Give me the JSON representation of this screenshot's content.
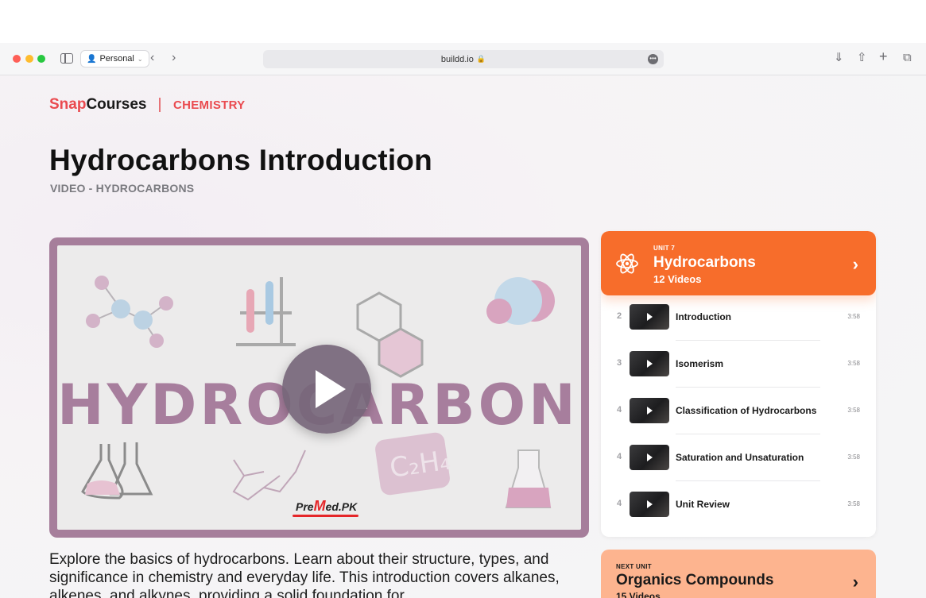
{
  "browser": {
    "profile_label": "Personal",
    "url": "buildd.io"
  },
  "brand": {
    "snap": "Snap",
    "courses": "Courses",
    "subject": "CHEMISTRY"
  },
  "page": {
    "title": "Hydrocarbons Introduction",
    "subtitle": "VIDEO - HYDROCARBONS",
    "description": "Explore the basics of hydrocarbons. Learn about their structure, types, and significance in chemistry and everyday life. This introduction covers alkanes, alkenes, and alkynes, providing a solid foundation for"
  },
  "video": {
    "thumbnail_text": "HYDROCARBONS",
    "logo_pre": "Pre",
    "logo_m": "M",
    "logo_post": "ed.PK"
  },
  "unit": {
    "label": "UNIT 7",
    "title": "Hydrocarbons",
    "count": "12 Videos",
    "icon": "atom-icon",
    "color": "#f76d2b",
    "lessons": [
      {
        "num": "2",
        "title": "Introduction",
        "duration": "3:58"
      },
      {
        "num": "3",
        "title": "Isomerism",
        "duration": "3:58"
      },
      {
        "num": "4",
        "title": "Classification of Hydrocarbons",
        "duration": "3:58"
      },
      {
        "num": "4",
        "title": "Saturation and Unsaturation",
        "duration": "3:58"
      },
      {
        "num": "4",
        "title": "Unit Review",
        "duration": "3:58"
      }
    ]
  },
  "next_unit": {
    "label": "NEXT UNIT",
    "title": "Organics Compounds",
    "count": "15 Videos",
    "color": "#fdb48f"
  }
}
